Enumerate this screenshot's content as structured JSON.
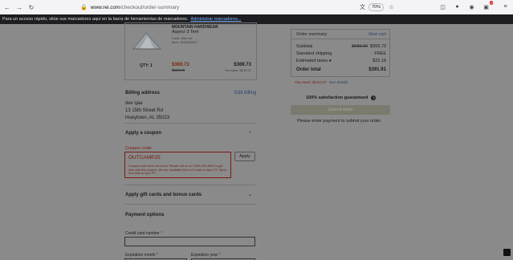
{
  "browser": {
    "url_domain": "www.rei.com",
    "url_path": "/checkout/order-summary",
    "zoom": "70%",
    "notification_count": "2"
  },
  "bookmarks": {
    "message": "Para un acceso rápido, sitúe sus marcadores aquí en la barra de herramientas de marcadores.",
    "link": "Administrar marcadores..."
  },
  "product": {
    "brand": "MOUNTAIN HARDWEAR",
    "name": "Aspect 3 Tent",
    "color": "Color: blue ice",
    "item": "Item: 1405045117",
    "qty": "QTY: 1",
    "sale_price": "$369.73",
    "orig_price": "$580.00",
    "total": "$369.73",
    "savings": "You save: $210.27"
  },
  "billing": {
    "title": "Billing address",
    "edit": "Edit billing",
    "name": "dev qaa",
    "street": "13 15th Street Rd",
    "city": "Hueytown, AL 35023"
  },
  "coupon": {
    "title": "Apply a coupon",
    "label": "Coupon code",
    "value": "OUTCAMP25",
    "error": "Coupon code were not found. Please call us at 1-800-426-4840 to get help with this coupon. We are available Mon to Fri 6am to 8pm PT, Sat to Sun 8am to 5pm PT.",
    "apply": "Apply"
  },
  "gift": {
    "title": "Apply gift cards and bonus cards"
  },
  "payment": {
    "title": "Payment options",
    "cc_label": "Credit card number",
    "month_label": "Expiration month",
    "year_label": "Expiration year",
    "req": "*"
  },
  "summary": {
    "title": "Order summary",
    "view_cart": "View cart",
    "subtotal_label": "Subtotal",
    "subtotal_orig": "$580.00",
    "subtotal": "$369.73",
    "shipping_label": "Standard shipping",
    "shipping": "FREE",
    "taxes_label": "Estimated taxes",
    "taxes": "$22.18",
    "total_label": "Order total",
    "total": "$391.91",
    "you_save": "You save: $210.27",
    "see_details": "See details",
    "guarantee": "100% satisfaction guaranteed",
    "submit": "Submit order",
    "note": "Please enter payment to submit your order."
  }
}
